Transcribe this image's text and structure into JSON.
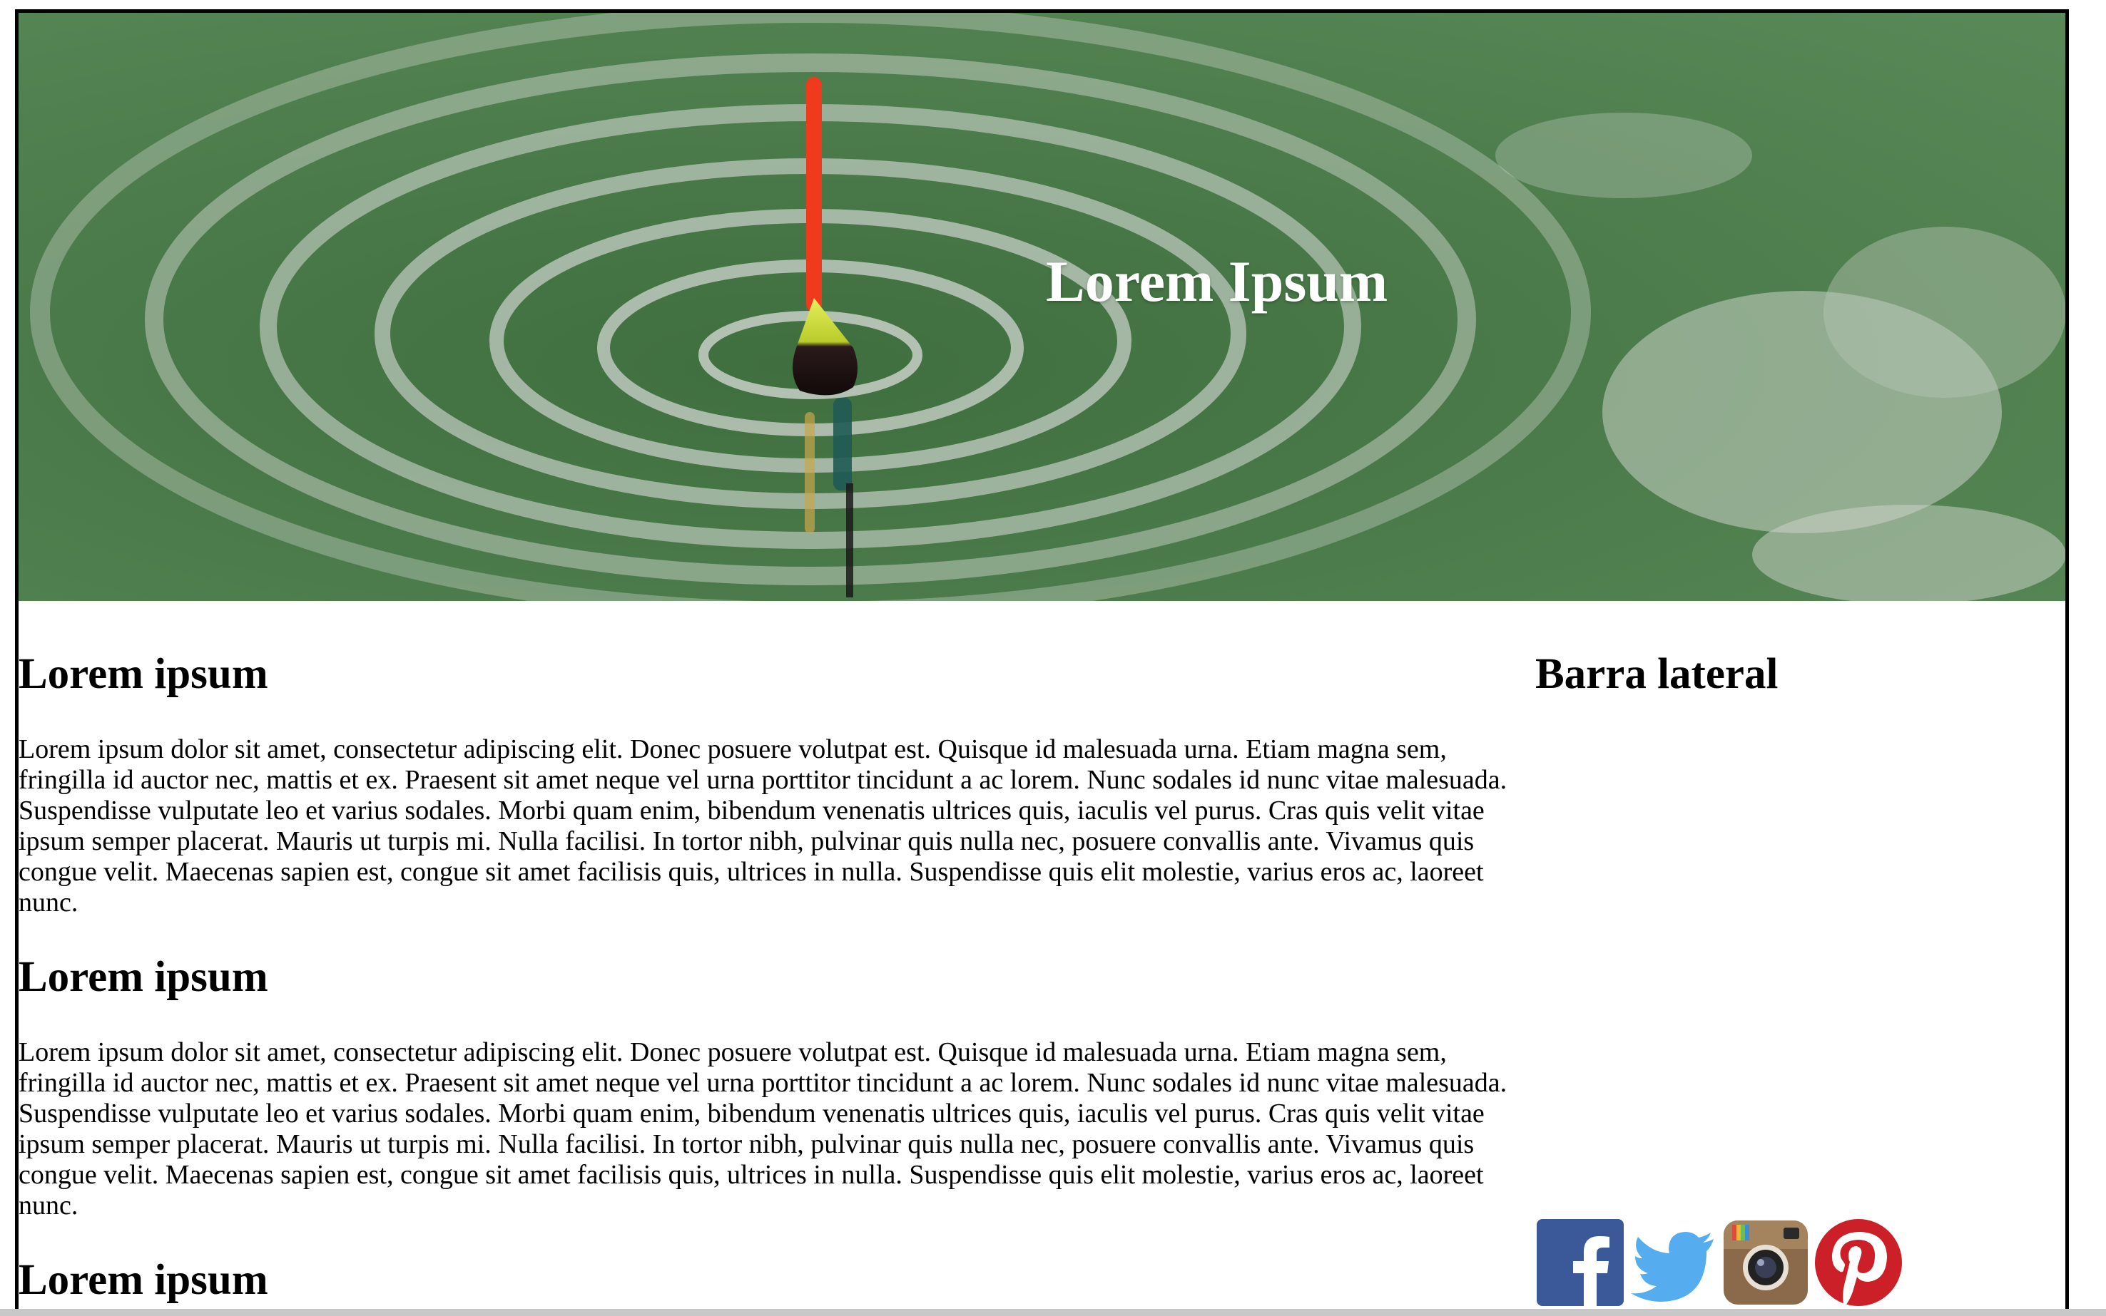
{
  "header": {
    "title": "Lorem Ipsum",
    "image": "fishing-float-water-ripples"
  },
  "main": {
    "sections": [
      {
        "heading": "Lorem ipsum",
        "body": "Lorem ipsum dolor sit amet, consectetur adipiscing elit. Donec posuere volutpat est. Quisque id malesuada urna. Etiam magna sem, fringilla id auctor nec, mattis et ex. Praesent sit amet neque vel urna porttitor tincidunt a ac lorem. Nunc sodales id nunc vitae malesuada. Suspendisse vulputate leo et varius sodales. Morbi quam enim, bibendum venenatis ultrices quis, iaculis vel purus. Cras quis velit vitae ipsum semper placerat. Mauris ut turpis mi. Nulla facilisi. In tortor nibh, pulvinar quis nulla nec, posuere convallis ante. Vivamus quis congue velit. Maecenas sapien est, congue sit amet facilisis quis, ultrices in nulla. Suspendisse quis elit molestie, varius eros ac, laoreet nunc."
      },
      {
        "heading": "Lorem ipsum",
        "body": "Lorem ipsum dolor sit amet, consectetur adipiscing elit. Donec posuere volutpat est. Quisque id malesuada urna. Etiam magna sem, fringilla id auctor nec, mattis et ex. Praesent sit amet neque vel urna porttitor tincidunt a ac lorem. Nunc sodales id nunc vitae malesuada. Suspendisse vulputate leo et varius sodales. Morbi quam enim, bibendum venenatis ultrices quis, iaculis vel purus. Cras quis velit vitae ipsum semper placerat. Mauris ut turpis mi. Nulla facilisi. In tortor nibh, pulvinar quis nulla nec, posuere convallis ante. Vivamus quis congue velit. Maecenas sapien est, congue sit amet facilisis quis, ultrices in nulla. Suspendisse quis elit molestie, varius eros ac, laoreet nunc."
      },
      {
        "heading": "Lorem ipsum"
      }
    ]
  },
  "sidebar": {
    "title": "Barra lateral",
    "social": [
      {
        "icon": "facebook-icon",
        "color": "#3b5998"
      },
      {
        "icon": "twitter-icon",
        "color": "#55acee"
      },
      {
        "icon": "instagram-icon",
        "color": "#8a6a4a"
      },
      {
        "icon": "pinterest-icon",
        "color": "#cb2027"
      }
    ]
  }
}
